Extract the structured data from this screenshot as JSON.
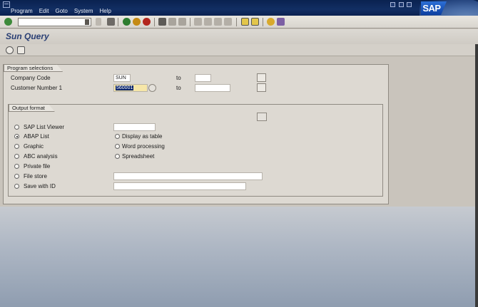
{
  "menu": [
    "Program",
    "Edit",
    "Goto",
    "System",
    "Help"
  ],
  "logo_text": "SAP",
  "toolbar": {
    "command_value": "",
    "icons": [
      "enter-icon",
      "save-icon",
      "back-icon",
      "exit-icon",
      "cancel-icon",
      "print-icon",
      "find-icon",
      "find-next-icon",
      "first-page-icon",
      "previous-page-icon",
      "next-page-icon",
      "last-page-icon",
      "new-session-icon",
      "shortcut-icon",
      "help-icon",
      "layout-icon"
    ]
  },
  "title": "Sun Query",
  "app_toolbar_icons": [
    "execute-icon",
    "get-variant-icon"
  ],
  "program_selections": {
    "title": "Program selections",
    "rows": [
      {
        "label": "Company Code",
        "low": "SUN",
        "to_label": "to",
        "high": ""
      },
      {
        "label": "Customer Number 1",
        "low": "560001",
        "to_label": "to",
        "high": ""
      }
    ]
  },
  "output_format": {
    "title": "Output format",
    "options": [
      {
        "label": "SAP List Viewer",
        "selected": false
      },
      {
        "label": "ABAP List",
        "selected": true
      },
      {
        "label": "Graphic",
        "selected": false
      },
      {
        "label": "ABC analysis",
        "selected": false
      },
      {
        "label": "Private file",
        "selected": false
      },
      {
        "label": "File store",
        "selected": false
      },
      {
        "label": "Save with ID",
        "selected": false
      }
    ],
    "sub_options": [
      {
        "label": "Display as table",
        "selected": false
      },
      {
        "label": "Word processing",
        "selected": false
      },
      {
        "label": "Spreadsheet",
        "selected": false
      }
    ]
  },
  "colors": {
    "menubar": "#0a2250",
    "title": "#2a3f74",
    "highlight": "#0a246a"
  }
}
